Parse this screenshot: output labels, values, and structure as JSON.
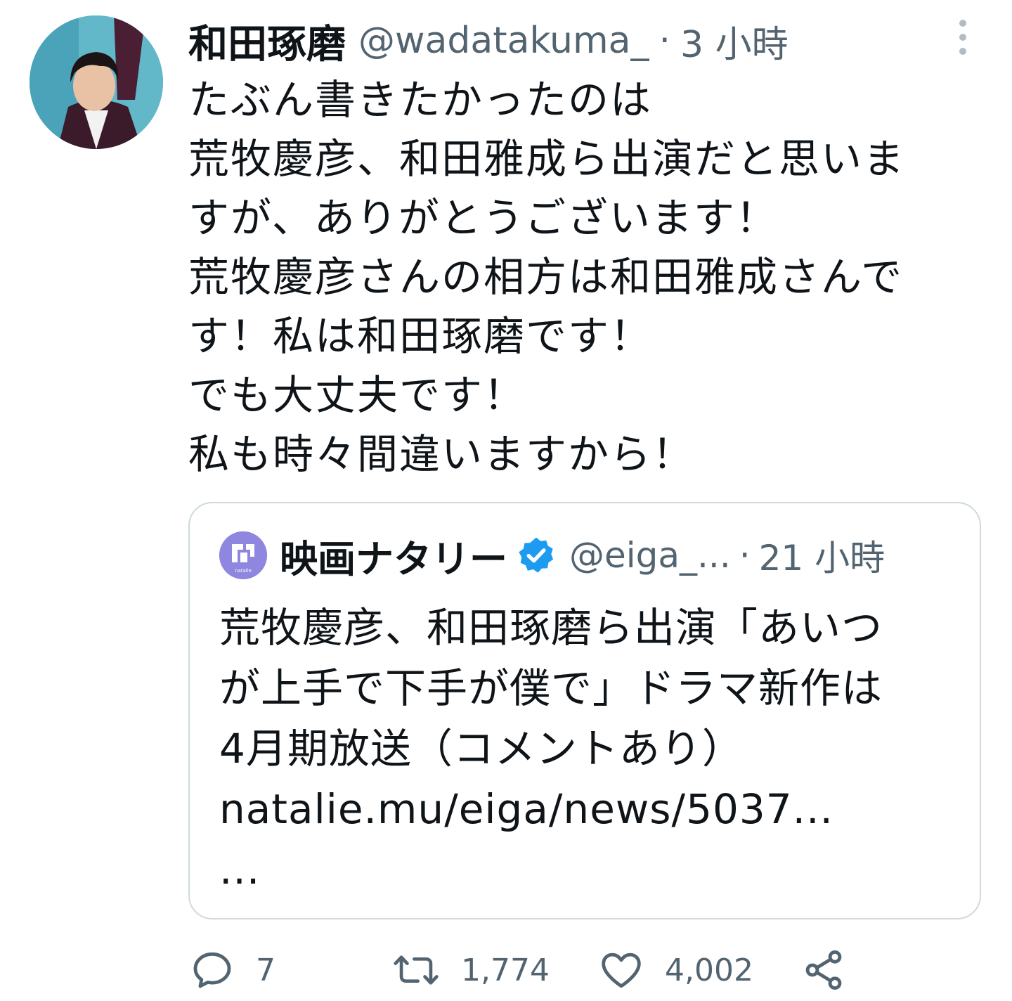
{
  "author": {
    "display_name": "和田琢磨",
    "handle": "@wadatakuma_",
    "separator": "·",
    "time": "3 小時"
  },
  "tweet_lines": [
    "たぶん書きたかったのは",
    "荒牧慶彦、和田雅成ら出演だと思いま",
    "すが、ありがとうございます！",
    "荒牧慶彦さんの相方は和田雅成さんで",
    "す！私は和田琢磨です！",
    "でも大丈夫です！",
    "私も時々間違いますから！"
  ],
  "quoted": {
    "display_name": "映画ナタリー",
    "handle": "@eiga_...",
    "separator": "·",
    "time": "21 小時",
    "avatar_caption": "natalie",
    "lines": [
      "荒牧慶彦、和田琢磨ら出演「あいつ",
      "が上手で下手が僕で」ドラマ新作は",
      "4月期放送（コメントあり）",
      "natalie.mu/eiga/news/5037...",
      "..."
    ]
  },
  "actions": {
    "reply_count": "7",
    "retweet_count": "1,774",
    "like_count": "4,002",
    "icons": [
      "reply-icon",
      "retweet-icon",
      "like-icon",
      "share-icon"
    ]
  },
  "colors": {
    "text": "#0f1419",
    "secondary": "#536471",
    "border": "#cfd9de",
    "verified": "#1d9bf0"
  }
}
